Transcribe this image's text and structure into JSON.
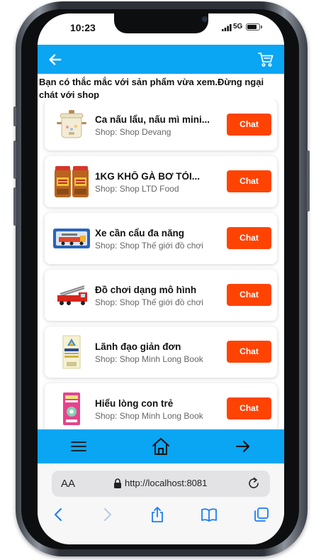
{
  "status_bar": {
    "time": "10:23",
    "network": "5G"
  },
  "header": {
    "back_icon": "arrow-left-icon",
    "cart_icon": "shopping-cart-icon",
    "background": "#0aa5f3"
  },
  "notice": "Bạn có thắc mắc với sản phẩm vừa xem.Đừng ngại chát với shop",
  "products": [
    {
      "name": "Ca nấu lẩu, nấu mì mini...",
      "shop": "Shop: Shop Devang",
      "chat_label": "Chat"
    },
    {
      "name": "1KG KHÔ GÀ BƠ TỎI...",
      "shop": "Shop: Shop LTD Food",
      "chat_label": "Chat"
    },
    {
      "name": "Xe cần cẩu đa năng",
      "shop": "Shop: Shop Thế giới đồ chơi",
      "chat_label": "Chat"
    },
    {
      "name": "Đồ chơi dạng mô hình",
      "shop": "Shop: Shop Thế giới đồ chơi",
      "chat_label": "Chat"
    },
    {
      "name": "Lãnh đạo giản đơn",
      "shop": "Shop: Shop Minh Long Book",
      "chat_label": "Chat"
    },
    {
      "name": "Hiểu lòng con trẻ",
      "shop": "Shop: Shop Minh Long Book",
      "chat_label": "Chat"
    }
  ],
  "bottom_nav": {
    "items": [
      "menu-icon",
      "home-icon",
      "arrow-right-icon"
    ]
  },
  "browser": {
    "text_size_label": "AA",
    "url": "http://localhost:8081",
    "toolbar": [
      "back-icon",
      "forward-icon",
      "share-icon",
      "bookmarks-icon",
      "tabs-icon"
    ]
  },
  "colors": {
    "accent": "#0aa5f3",
    "chat_button": "#ff4303",
    "browser_tint": "#1b7cf5"
  }
}
